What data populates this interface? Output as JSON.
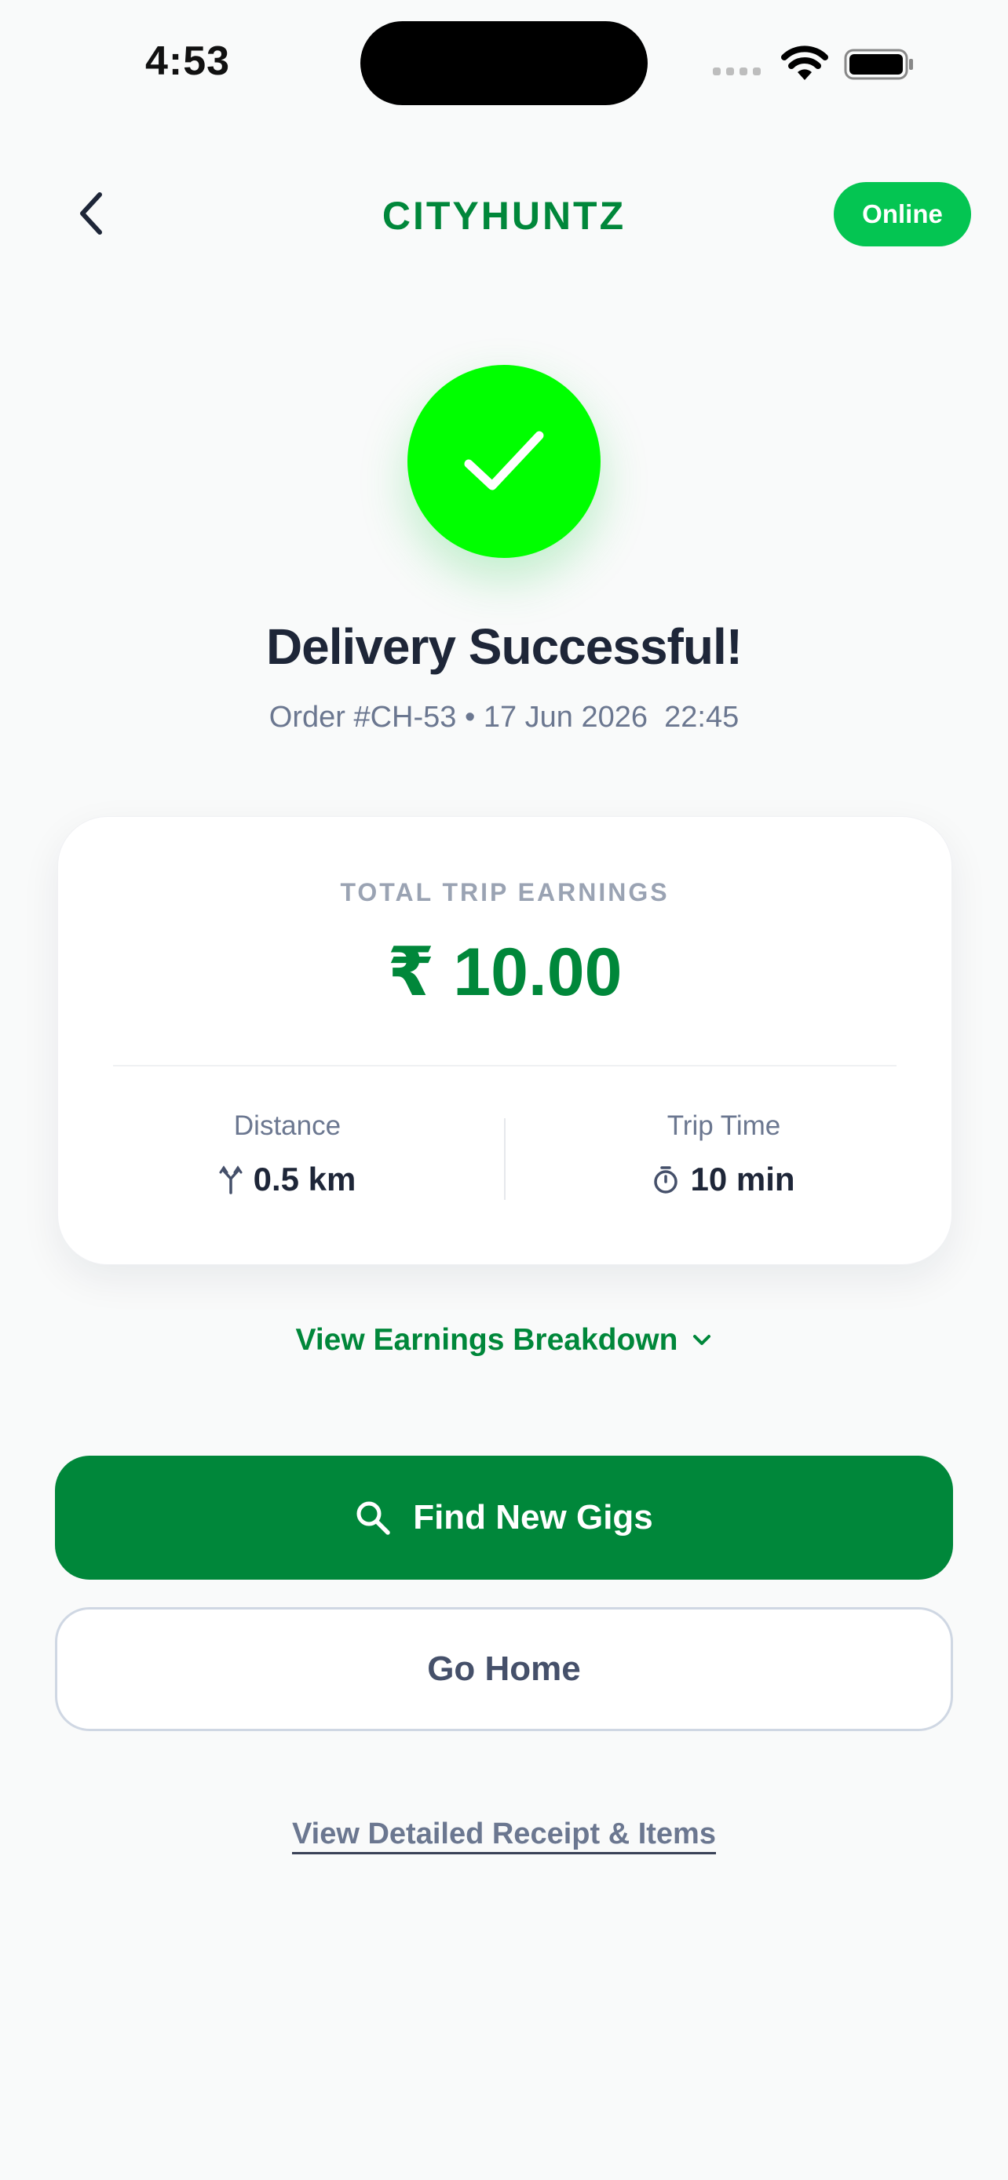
{
  "status_bar": {
    "time": "4:53"
  },
  "header": {
    "brand": "CITYHUNTZ",
    "status_badge": "Online"
  },
  "hero": {
    "title": "Delivery Successful!",
    "order_line": "Order #CH-53 • 17 Jun 2026  22:45"
  },
  "earnings": {
    "label": "TOTAL TRIP EARNINGS",
    "amount": "₹ 10.00",
    "distance_label": "Distance",
    "distance_value": "0.5 km",
    "trip_time_label": "Trip Time",
    "trip_time_value": "10 min"
  },
  "actions": {
    "breakdown_label": "View Earnings Breakdown",
    "find_gigs_label": "Find New Gigs",
    "go_home_label": "Go Home",
    "receipt_label": "View Detailed Receipt & Items"
  },
  "colors": {
    "brand_green": "#00873a",
    "online_green": "#04c552",
    "success_green": "#00ff00",
    "text_dark": "#1e2638",
    "text_muted": "#6b7790"
  }
}
